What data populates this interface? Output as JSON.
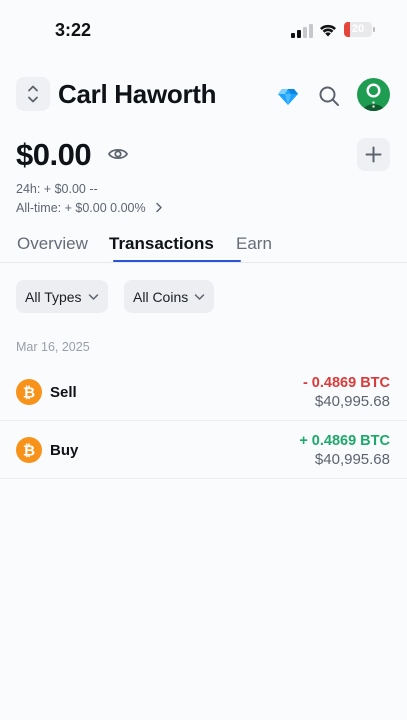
{
  "status_bar": {
    "time": "3:22",
    "battery_level": "20"
  },
  "header": {
    "account_name": "Carl Haworth"
  },
  "balance": {
    "amount": "$0.00",
    "change_24h": "24h:  + $0.00 --",
    "change_all_time": "All-time:  + $0.00 0.00%"
  },
  "tabs": [
    {
      "label": "Overview",
      "active": false
    },
    {
      "label": "Transactions",
      "active": true
    },
    {
      "label": "Earn",
      "active": false
    }
  ],
  "filters": {
    "types_label": "All Types",
    "coins_label": "All Coins"
  },
  "transactions": {
    "date": "Mar 16, 2025",
    "items": [
      {
        "type": "Sell",
        "amount": "- 0.4869 BTC",
        "fiat": "$40,995.68",
        "coin_symbol": "₿",
        "direction": "negative"
      },
      {
        "type": "Buy",
        "amount": "+ 0.4869 BTC",
        "fiat": "$40,995.68",
        "coin_symbol": "₿",
        "direction": "positive"
      }
    ]
  },
  "colors": {
    "accent": "#2a55d8",
    "negative": "#d93a3a",
    "positive": "#1ea86a",
    "bitcoin": "#f7931a",
    "avatar_bg": "#1e9d52",
    "gem": "#1aa3ff"
  },
  "icons": {
    "switch": "chevron-up-down-icon",
    "gem": "diamond-icon",
    "search": "search-icon",
    "avatar": "avatar-icon",
    "eye": "eye-icon",
    "add": "plus-icon",
    "chevron": "chevron-right-icon",
    "dropdown": "chevron-down-icon",
    "coin": "bitcoin-icon"
  }
}
